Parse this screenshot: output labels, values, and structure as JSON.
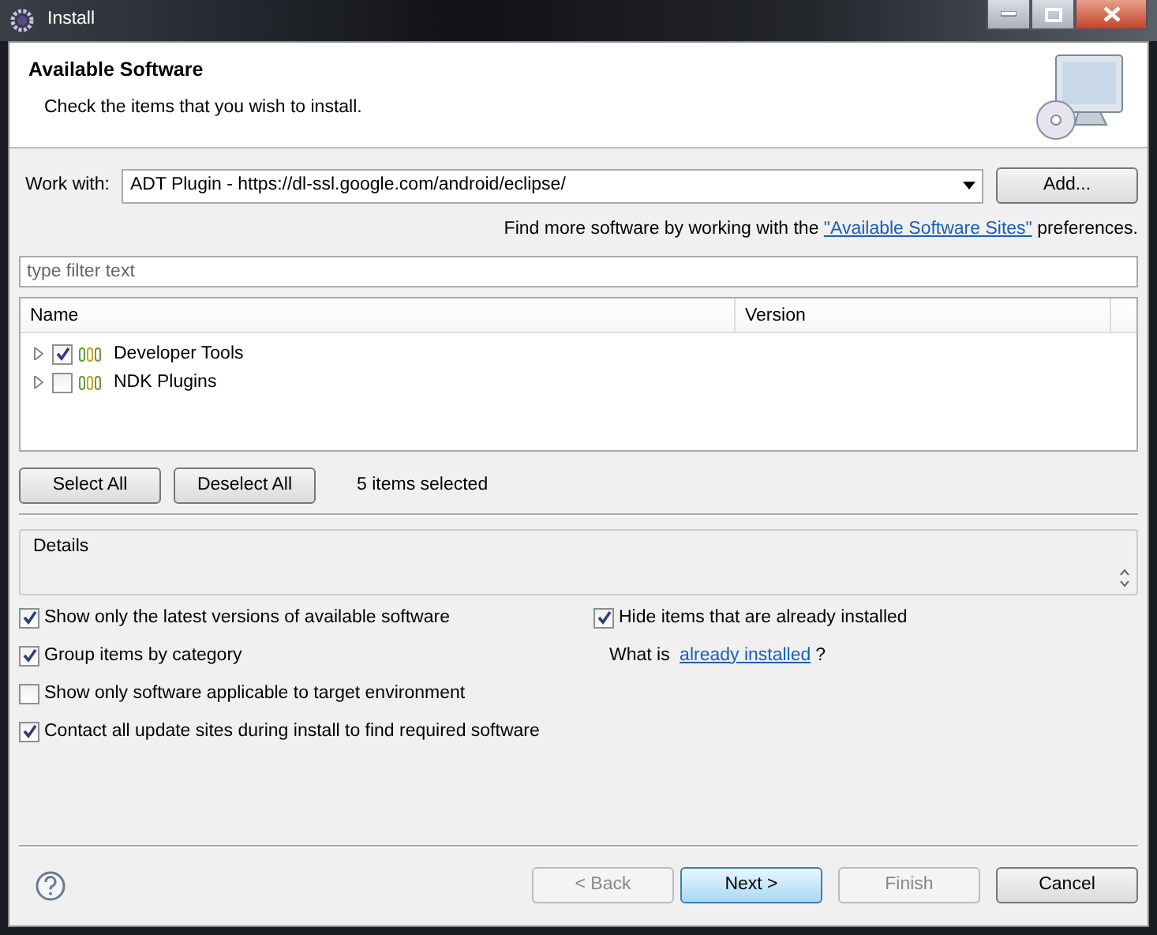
{
  "window": {
    "title": "Install"
  },
  "header": {
    "title": "Available Software",
    "subtitle": "Check the items that you wish to install."
  },
  "work_with": {
    "label": "Work with:",
    "value": "ADT Plugin - https://dl-ssl.google.com/android/eclipse/",
    "add_button": "Add...",
    "hint_before": "Find more software by working with the",
    "hint_link": "\"Available Software Sites\"",
    "hint_after": "preferences."
  },
  "filter": {
    "placeholder": "type filter text"
  },
  "tree": {
    "columns": [
      "Name",
      "Version"
    ],
    "rows": [
      {
        "label": "Developer Tools",
        "checked": true,
        "expanded": false
      },
      {
        "label": "NDK Plugins",
        "checked": false,
        "expanded": false
      }
    ]
  },
  "selection": {
    "buttons": [
      "Select All",
      "Deselect All"
    ],
    "count": "5 items selected"
  },
  "details": {
    "label": "Details"
  },
  "options_left": [
    {
      "label": "Show only the latest versions of available software",
      "checked": true
    },
    {
      "label": "Group items by category",
      "checked": true
    },
    {
      "label": "Show only software applicable to target environment",
      "checked": false
    },
    {
      "label": "Contact all update sites during install to find required software",
      "checked": true
    }
  ],
  "options_right": {
    "hide": {
      "label": "Hide items that are already installed",
      "checked": true
    },
    "what_before": "What is",
    "what_link": "already installed",
    "what_after": "?"
  },
  "footer": {
    "buttons": [
      {
        "label": "< Back",
        "disabled": true,
        "default": false
      },
      {
        "label": "Next >",
        "disabled": false,
        "default": true
      },
      {
        "label": "Finish",
        "disabled": true,
        "default": false
      },
      {
        "label": "Cancel",
        "disabled": false,
        "default": false
      }
    ]
  }
}
